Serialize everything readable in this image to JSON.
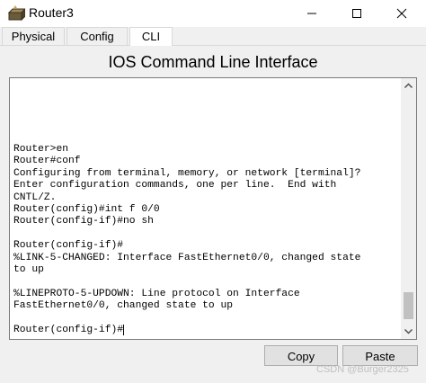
{
  "window": {
    "title": "Router3",
    "icon": "router-icon",
    "controls": [
      "minimize-icon",
      "maximize-icon",
      "close-icon"
    ]
  },
  "tabs": [
    {
      "label": "Physical",
      "active": false
    },
    {
      "label": "Config",
      "active": false
    },
    {
      "label": "CLI",
      "active": true
    }
  ],
  "heading": "IOS Command Line Interface",
  "terminal": {
    "lines": [
      "Router>en",
      "Router#conf",
      "Configuring from terminal, memory, or network [terminal]?",
      "Enter configuration commands, one per line.  End with",
      "CNTL/Z.",
      "Router(config)#int f 0/0",
      "Router(config-if)#no sh",
      "",
      "Router(config-if)#",
      "%LINK-5-CHANGED: Interface FastEthernet0/0, changed state",
      "to up",
      "",
      "%LINEPROTO-5-UPDOWN: Line protocol on Interface",
      "FastEthernet0/0, changed state to up",
      "",
      "Router(config-if)#"
    ]
  },
  "buttons": {
    "copy": "Copy",
    "paste": "Paste"
  },
  "watermark": "CSDN @Burger2325"
}
